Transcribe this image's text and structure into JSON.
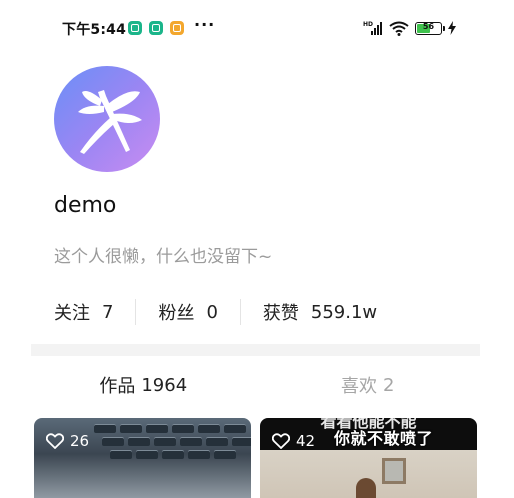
{
  "status_bar": {
    "time": "下午5:44",
    "more": "···",
    "network_label": "HD",
    "battery_level": "56",
    "battery_fraction": 0.56
  },
  "profile": {
    "username": "demo",
    "bio": "这个人很懒，什么也没留下~",
    "stats": [
      {
        "label": "关注",
        "value": "7"
      },
      {
        "label": "粉丝",
        "value": "0"
      },
      {
        "label": "获赞",
        "value": "559.1w"
      }
    ]
  },
  "tabs": [
    {
      "label": "作品",
      "count": "1964",
      "active": true
    },
    {
      "label": "喜欢",
      "count": "2",
      "active": false
    }
  ],
  "videos": [
    {
      "likes": "26",
      "caption": ""
    },
    {
      "likes": "42",
      "caption_top": "看看他能不能",
      "caption": "你就不敢喷了"
    }
  ],
  "colors": {
    "avatar_gradient_start": "#6a8ff7",
    "avatar_gradient_end": "#c98cf2",
    "battery": "#3fc24e",
    "muted_text": "#9b9b9b"
  }
}
